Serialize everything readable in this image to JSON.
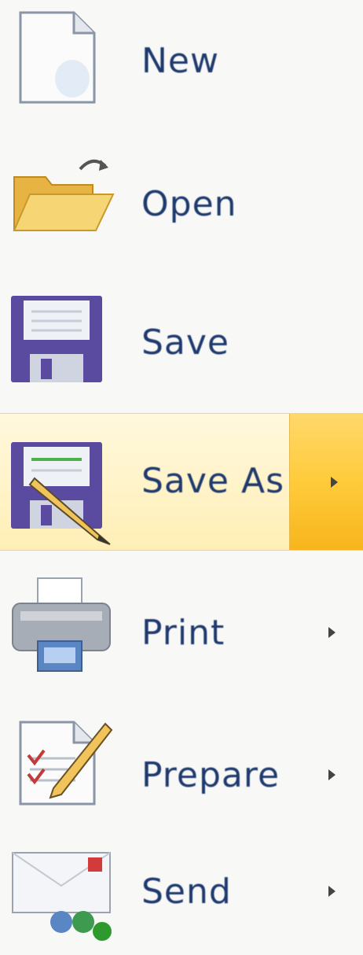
{
  "menu": {
    "items": [
      {
        "id": "new",
        "label": "New",
        "icon": "new-document-icon",
        "submenu": false
      },
      {
        "id": "open",
        "label": "Open",
        "icon": "open-folder-icon",
        "submenu": false
      },
      {
        "id": "save",
        "label": "Save",
        "icon": "floppy-disk-icon",
        "submenu": false
      },
      {
        "id": "save-as",
        "label": "Save As",
        "icon": "save-as-pencil-icon",
        "submenu": true,
        "selected": true
      },
      {
        "id": "print",
        "label": "Print",
        "icon": "printer-icon",
        "submenu": true
      },
      {
        "id": "prepare",
        "label": "Prepare",
        "icon": "prepare-document-icon",
        "submenu": true
      },
      {
        "id": "send",
        "label": "Send",
        "icon": "send-icon",
        "submenu": true
      }
    ]
  },
  "colors": {
    "label_text": "#1f3a6e",
    "highlight": "#fff3c8",
    "highlight_split": "#ffcb3b",
    "floppy": "#5a4aa0",
    "folder": "#f4cf63"
  }
}
